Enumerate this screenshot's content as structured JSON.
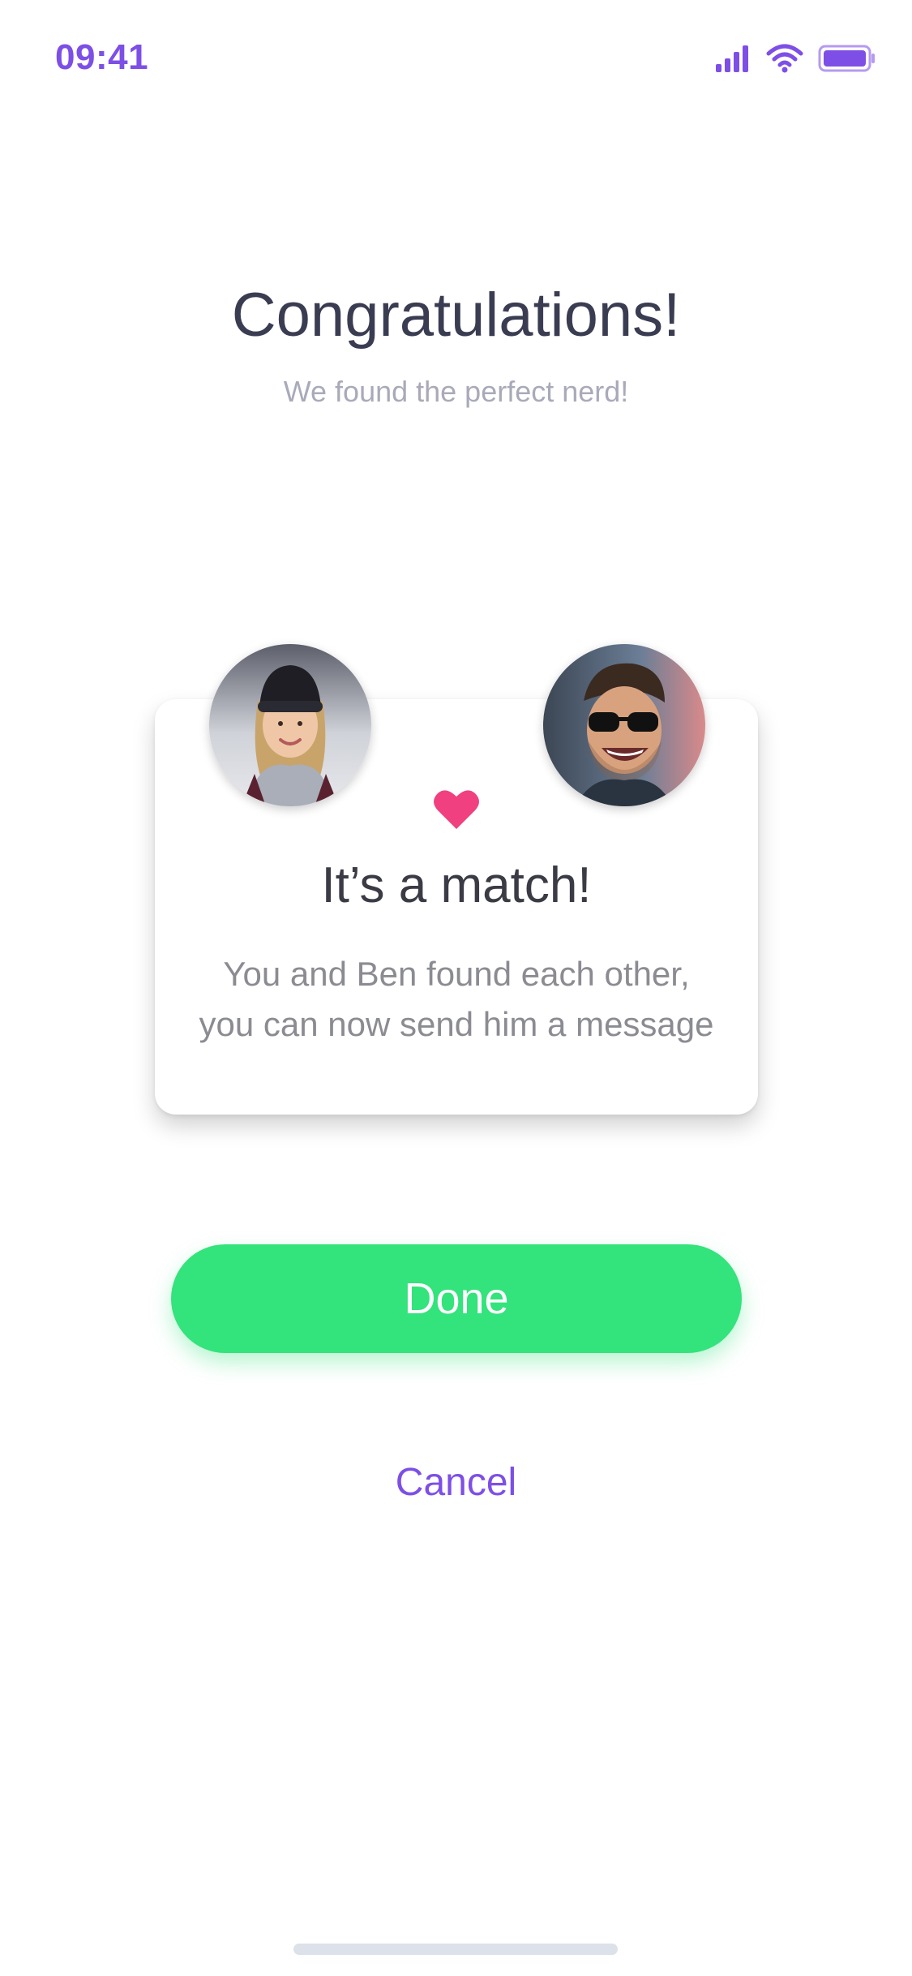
{
  "status_bar": {
    "time": "09:41",
    "icons": [
      "signal-icon",
      "wifi-icon",
      "battery-icon"
    ]
  },
  "header": {
    "title": "Congratulations!",
    "subtitle": "We found the perfect nerd!"
  },
  "match_card": {
    "avatars": [
      "avatar-left",
      "avatar-right"
    ],
    "heart_icon": "heart-icon",
    "title": "It’s a match!",
    "message_line1": "You and Ben found each other,",
    "message_line2": "you can now send him a message"
  },
  "actions": {
    "done_label": "Done",
    "cancel_label": "Cancel"
  },
  "colors": {
    "accent": "#7d4fe6",
    "done_button": "#33e37b",
    "heart": "#f0407f",
    "title_text": "#3a3d52",
    "subtitle_text": "#a9aab9"
  }
}
